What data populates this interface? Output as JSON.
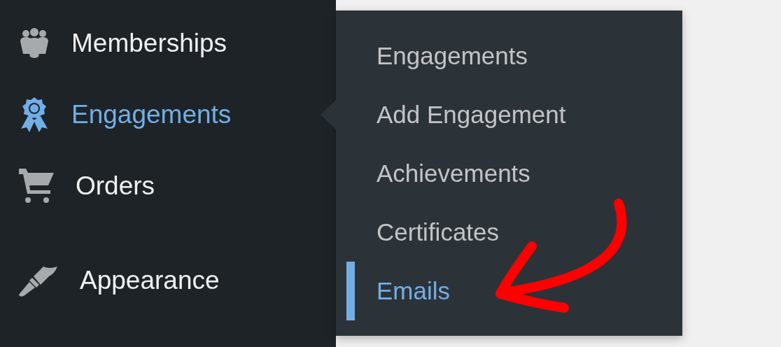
{
  "sidebar": {
    "items": [
      {
        "label": "Memberships",
        "selected": false
      },
      {
        "label": "Engagements",
        "selected": true
      },
      {
        "label": "Orders",
        "selected": false
      },
      {
        "label": "Appearance",
        "selected": false
      }
    ]
  },
  "submenu": {
    "items": [
      {
        "label": "Engagements",
        "selected": false
      },
      {
        "label": "Add Engagement",
        "selected": false
      },
      {
        "label": "Achievements",
        "selected": false
      },
      {
        "label": "Certificates",
        "selected": false
      },
      {
        "label": "Emails",
        "selected": true
      }
    ]
  }
}
